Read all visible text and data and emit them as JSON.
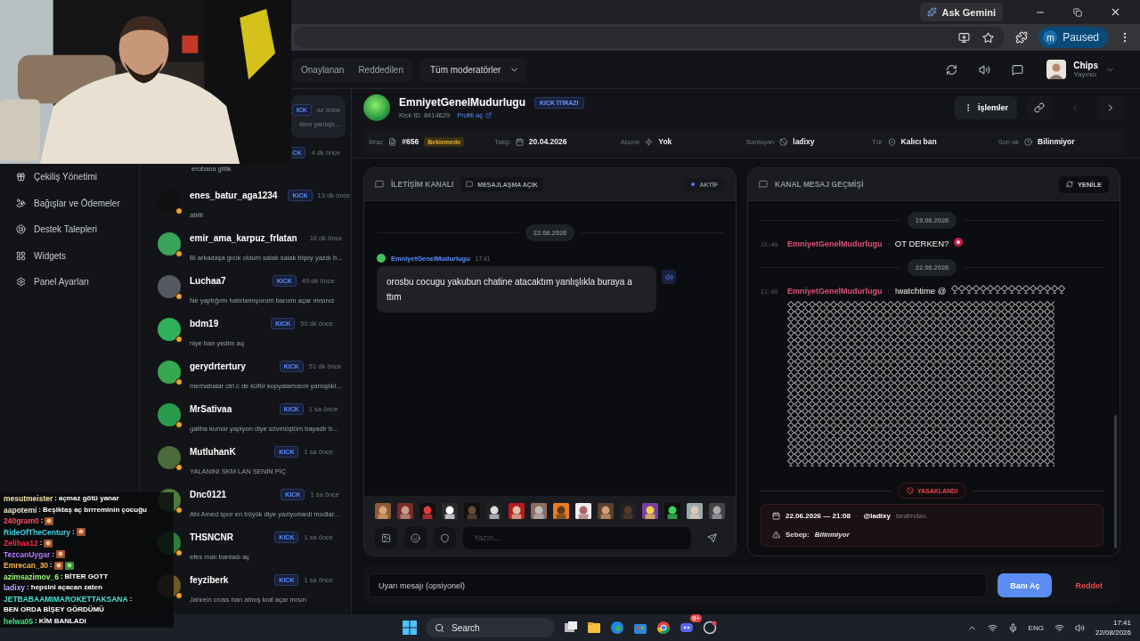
{
  "browser": {
    "ask_button": "Ask Gemini",
    "profile": {
      "initial": "m",
      "label": "Paused"
    }
  },
  "header": {
    "filters": [
      {
        "label": "Onaylanan",
        "selected": false
      },
      {
        "label": "Reddedilen",
        "selected": false
      }
    ],
    "moderator_select": "Tüm moderatörler",
    "user": {
      "name": "Chips",
      "role": "Yayıncı"
    }
  },
  "sidebar": {
    "items": [
      "Çekiliş Yönetimi",
      "Bağışlar ve Ödemeler",
      "Destek Talepleri",
      "Widgets",
      "Panel Ayarları"
    ]
  },
  "appeals": [
    {
      "badge": "ICK",
      "time": "az önce",
      "message": "ktım yanlışlı...",
      "selected": true
    },
    {
      "badge": "CK",
      "time": "4 dk önce",
      "message": "erobana gitlik",
      "selected": false
    },
    {
      "name": "enes_batur_aga1234",
      "badge": "KICK",
      "time": "13 dk önce",
      "message": "abiiii",
      "selected": false
    },
    {
      "name": "emir_ama_karpuz_frlatan",
      "time": "16 dk önce",
      "message": "Bi arkadaşa gıcık oldum salak salak bişey yazdı b...",
      "selected": false
    },
    {
      "name": "Luchaa7",
      "badge": "KICK",
      "time": "49 dk önce",
      "message": "Ne yaptığımı hatırlamıyorum banımı açar mısınız",
      "selected": false
    },
    {
      "name": "bdm19",
      "badge": "KICK",
      "time": "50 dk önce",
      "message": "niye ban yedim aq",
      "selected": false
    },
    {
      "name": "gerydrtertury",
      "badge": "KICK",
      "time": "51 dk önce",
      "message": "merhabalar ctrl c de küfür kopyalamısım yanlışlıkl...",
      "selected": false
    },
    {
      "name": "MrSativaa",
      "badge": "KICK",
      "time": "1 sa önce",
      "message": "galiba kumar yapiyon diye sövmüştüm bayadir b...",
      "selected": false
    },
    {
      "name": "MutluhanK",
      "badge": "KICK",
      "time": "1 sa önce",
      "message": "YALANINI SKM LAN SENİN PİÇ",
      "selected": false
    },
    {
      "name": "Dnc0121",
      "badge": "KICK",
      "time": "1 sa önce",
      "message": "Abi Amed spor en büyük diye yaziyorlardi modlar...",
      "selected": false
    },
    {
      "name": "THSNCNR",
      "badge": "KICK",
      "time": "1 sa önce",
      "message": "efes malı banladı aç",
      "selected": false
    },
    {
      "name": "feyziberk",
      "badge": "KICK",
      "time": "1 sa önce",
      "message": "Jahrein cross ban atmış kral açar mısın",
      "selected": false
    }
  ],
  "appeal": {
    "name": "EmniyetGenelMudurlugu",
    "badge": "KICK İTİRAZI",
    "kick_id": "Kick ID: 8414629",
    "profile_link": "Profili aç",
    "actions_button": "İşlemler",
    "pager": {
      "previous_disabled": true,
      "next_disabled": false
    },
    "meta": [
      {
        "label": "İtiraz",
        "value": "#656",
        "badge": "Beklemede"
      },
      {
        "label": "Takip",
        "value": "20.04.2026"
      },
      {
        "label": "Abone",
        "value": "Yok"
      },
      {
        "label": "Banlayan",
        "value": "ladixy"
      },
      {
        "label": "Tür",
        "value": "Kalıcı ban"
      },
      {
        "label": "Son ak",
        "value": "Bilinmiyor"
      }
    ]
  },
  "chat_panel": {
    "title": "İLETİŞİM KANALI",
    "tag": "MESAJLAŞMA AÇIK",
    "status": "AKTİF",
    "date": "22.08.2026",
    "message": {
      "author": "EmniyetGenelMudurlugu",
      "time": "17:41",
      "text": "orosbu cocugu yakubun chatine atacaktım yanlışlıkla buraya a ttım"
    },
    "input": {
      "placeholder": "Yazın..."
    }
  },
  "history_panel": {
    "title": "KANAL MESAJ GEÇMİŞİ",
    "refresh_button": "YENİLE",
    "entries": [
      {
        "kind": "date",
        "text": "19.06.2026"
      },
      {
        "kind": "message",
        "time": "15:49",
        "author": "EmniyetGenelMudurlugu",
        "separator": ":",
        "text": "OT DERKEN?",
        "attachment": {
          "kind": "emote"
        }
      },
      {
        "kind": "date",
        "text": "22.06.2026"
      },
      {
        "kind": "message",
        "time": "21:08",
        "author": "EmniyetGenelMudurlugu",
        "separator": ":",
        "text": "!watchtime @",
        "attachment": {
          "kind": "pattern"
        }
      }
    ],
    "ban": {
      "status": "YASAKLANDI",
      "datetime": "22.06.2026 — 21:08",
      "separator": "·",
      "moderator": "@ladixy",
      "suffix": "tarafından.",
      "reason_label": "Sebep:",
      "reason": "Bilinmiyor"
    }
  },
  "footer": {
    "warning_placeholder": "Uyarı mesajı (opsiyonel)",
    "unban_button": "Banı Aç",
    "reject_button": "Reddet"
  },
  "stream_chat": [
    {
      "user": "mesutmeister",
      "color": "#f0e0a0",
      "separator": ":",
      "kind": "text",
      "text": "açmaz götü yanar"
    },
    {
      "user": "aapotemi",
      "color": "#f0e6c8",
      "separator": ":",
      "kind": "text",
      "text": "Beşiktaş aç brrreminin çocuğu"
    },
    {
      "user": "240gram0",
      "color": "#ff4d5e",
      "separator": ":",
      "kind": "emote"
    },
    {
      "user": "RideOfTheCentury",
      "color": "#3fd6e6",
      "separator": ":",
      "kind": "emote"
    },
    {
      "user": "Zelihaa12",
      "color": "#ff2a44",
      "separator": ":",
      "kind": "emote"
    },
    {
      "user": "TezcanUygar",
      "color": "#b07aff",
      "separator": ":",
      "kind": "emote"
    },
    {
      "user": "Emrecan_30",
      "color": "#ffb347",
      "separator": ":",
      "kind": "emotes"
    },
    {
      "user": "azimsazimov_6",
      "color": "#9dff7a",
      "separator": ":",
      "kind": "text",
      "text": "BİTER GOTT"
    },
    {
      "user": "ladixy",
      "color": "#b4a8ff",
      "separator": ":",
      "kind": "text",
      "text": "hepsini açacan zaten"
    },
    {
      "user": "JETBABAAMIMAROKETTAKSANA",
      "color": "#4de0d0",
      "separator": ":",
      "kind": "text",
      "text": "BEN ORDA BİŞEY GÖRDÜMÜ"
    },
    {
      "user": "helwa05",
      "color": "#3ee07a",
      "separator": ":",
      "kind": "text",
      "text": "KİM BANLADI"
    }
  ],
  "taskbar": {
    "search": "Search",
    "notification": "9+",
    "language": "ENG",
    "time": "17:41",
    "date": "22/08/2026"
  }
}
